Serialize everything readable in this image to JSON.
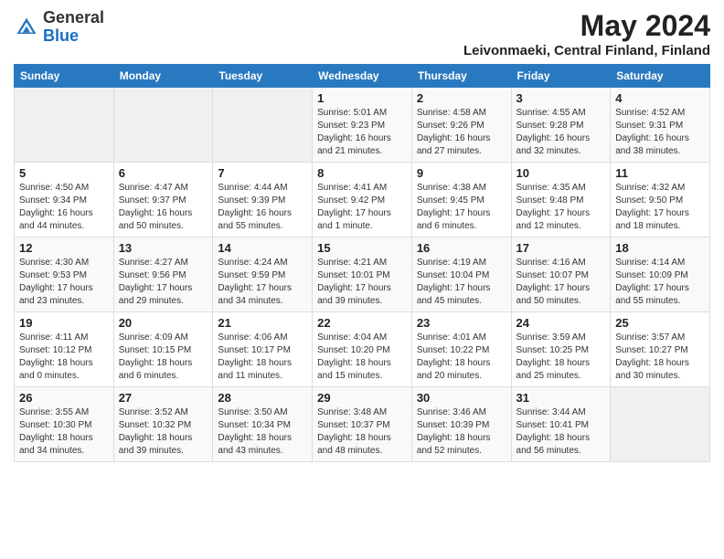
{
  "logo": {
    "line1": "General",
    "line2": "Blue"
  },
  "title": "May 2024",
  "subtitle": "Leivonmaeki, Central Finland, Finland",
  "days_of_week": [
    "Sunday",
    "Monday",
    "Tuesday",
    "Wednesday",
    "Thursday",
    "Friday",
    "Saturday"
  ],
  "weeks": [
    [
      {
        "day": "",
        "info": ""
      },
      {
        "day": "",
        "info": ""
      },
      {
        "day": "",
        "info": ""
      },
      {
        "day": "1",
        "info": "Sunrise: 5:01 AM\nSunset: 9:23 PM\nDaylight: 16 hours\nand 21 minutes."
      },
      {
        "day": "2",
        "info": "Sunrise: 4:58 AM\nSunset: 9:26 PM\nDaylight: 16 hours\nand 27 minutes."
      },
      {
        "day": "3",
        "info": "Sunrise: 4:55 AM\nSunset: 9:28 PM\nDaylight: 16 hours\nand 32 minutes."
      },
      {
        "day": "4",
        "info": "Sunrise: 4:52 AM\nSunset: 9:31 PM\nDaylight: 16 hours\nand 38 minutes."
      }
    ],
    [
      {
        "day": "5",
        "info": "Sunrise: 4:50 AM\nSunset: 9:34 PM\nDaylight: 16 hours\nand 44 minutes."
      },
      {
        "day": "6",
        "info": "Sunrise: 4:47 AM\nSunset: 9:37 PM\nDaylight: 16 hours\nand 50 minutes."
      },
      {
        "day": "7",
        "info": "Sunrise: 4:44 AM\nSunset: 9:39 PM\nDaylight: 16 hours\nand 55 minutes."
      },
      {
        "day": "8",
        "info": "Sunrise: 4:41 AM\nSunset: 9:42 PM\nDaylight: 17 hours\nand 1 minute."
      },
      {
        "day": "9",
        "info": "Sunrise: 4:38 AM\nSunset: 9:45 PM\nDaylight: 17 hours\nand 6 minutes."
      },
      {
        "day": "10",
        "info": "Sunrise: 4:35 AM\nSunset: 9:48 PM\nDaylight: 17 hours\nand 12 minutes."
      },
      {
        "day": "11",
        "info": "Sunrise: 4:32 AM\nSunset: 9:50 PM\nDaylight: 17 hours\nand 18 minutes."
      }
    ],
    [
      {
        "day": "12",
        "info": "Sunrise: 4:30 AM\nSunset: 9:53 PM\nDaylight: 17 hours\nand 23 minutes."
      },
      {
        "day": "13",
        "info": "Sunrise: 4:27 AM\nSunset: 9:56 PM\nDaylight: 17 hours\nand 29 minutes."
      },
      {
        "day": "14",
        "info": "Sunrise: 4:24 AM\nSunset: 9:59 PM\nDaylight: 17 hours\nand 34 minutes."
      },
      {
        "day": "15",
        "info": "Sunrise: 4:21 AM\nSunset: 10:01 PM\nDaylight: 17 hours\nand 39 minutes."
      },
      {
        "day": "16",
        "info": "Sunrise: 4:19 AM\nSunset: 10:04 PM\nDaylight: 17 hours\nand 45 minutes."
      },
      {
        "day": "17",
        "info": "Sunrise: 4:16 AM\nSunset: 10:07 PM\nDaylight: 17 hours\nand 50 minutes."
      },
      {
        "day": "18",
        "info": "Sunrise: 4:14 AM\nSunset: 10:09 PM\nDaylight: 17 hours\nand 55 minutes."
      }
    ],
    [
      {
        "day": "19",
        "info": "Sunrise: 4:11 AM\nSunset: 10:12 PM\nDaylight: 18 hours\nand 0 minutes."
      },
      {
        "day": "20",
        "info": "Sunrise: 4:09 AM\nSunset: 10:15 PM\nDaylight: 18 hours\nand 6 minutes."
      },
      {
        "day": "21",
        "info": "Sunrise: 4:06 AM\nSunset: 10:17 PM\nDaylight: 18 hours\nand 11 minutes."
      },
      {
        "day": "22",
        "info": "Sunrise: 4:04 AM\nSunset: 10:20 PM\nDaylight: 18 hours\nand 15 minutes."
      },
      {
        "day": "23",
        "info": "Sunrise: 4:01 AM\nSunset: 10:22 PM\nDaylight: 18 hours\nand 20 minutes."
      },
      {
        "day": "24",
        "info": "Sunrise: 3:59 AM\nSunset: 10:25 PM\nDaylight: 18 hours\nand 25 minutes."
      },
      {
        "day": "25",
        "info": "Sunrise: 3:57 AM\nSunset: 10:27 PM\nDaylight: 18 hours\nand 30 minutes."
      }
    ],
    [
      {
        "day": "26",
        "info": "Sunrise: 3:55 AM\nSunset: 10:30 PM\nDaylight: 18 hours\nand 34 minutes."
      },
      {
        "day": "27",
        "info": "Sunrise: 3:52 AM\nSunset: 10:32 PM\nDaylight: 18 hours\nand 39 minutes."
      },
      {
        "day": "28",
        "info": "Sunrise: 3:50 AM\nSunset: 10:34 PM\nDaylight: 18 hours\nand 43 minutes."
      },
      {
        "day": "29",
        "info": "Sunrise: 3:48 AM\nSunset: 10:37 PM\nDaylight: 18 hours\nand 48 minutes."
      },
      {
        "day": "30",
        "info": "Sunrise: 3:46 AM\nSunset: 10:39 PM\nDaylight: 18 hours\nand 52 minutes."
      },
      {
        "day": "31",
        "info": "Sunrise: 3:44 AM\nSunset: 10:41 PM\nDaylight: 18 hours\nand 56 minutes."
      },
      {
        "day": "",
        "info": ""
      }
    ]
  ]
}
